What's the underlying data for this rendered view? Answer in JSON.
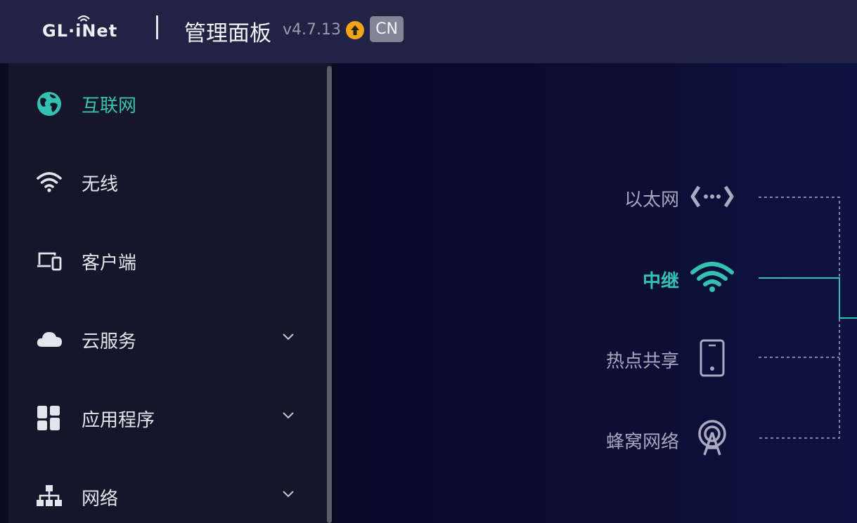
{
  "header": {
    "logo": "GL·iNet",
    "title": "管理面板",
    "version": "v4.7.13",
    "language": "CN",
    "upgrade_icon": "upgrade-arrow-icon"
  },
  "sidebar": {
    "items": [
      {
        "label": "互联网",
        "icon": "globe-icon",
        "active": true,
        "expandable": false
      },
      {
        "label": "无线",
        "icon": "wifi-icon",
        "active": false,
        "expandable": false
      },
      {
        "label": "客户端",
        "icon": "devices-icon",
        "active": false,
        "expandable": false
      },
      {
        "label": "云服务",
        "icon": "cloud-icon",
        "active": false,
        "expandable": true
      },
      {
        "label": "应用程序",
        "icon": "apps-grid-icon",
        "active": false,
        "expandable": true
      },
      {
        "label": "网络",
        "icon": "network-tree-icon",
        "active": false,
        "expandable": true
      }
    ]
  },
  "connections": [
    {
      "label": "以太网",
      "icon": "ethernet-icon",
      "active": false
    },
    {
      "label": "中继",
      "icon": "wifi-repeater-icon",
      "active": true
    },
    {
      "label": "热点共享",
      "icon": "phone-icon",
      "active": false
    },
    {
      "label": "蜂窝网络",
      "icon": "cellular-tower-icon",
      "active": false
    }
  ],
  "colors": {
    "accent": "#33c1b1",
    "header_bg": "#222344",
    "sidebar_bg": "#16162a",
    "upgrade": "#f0a51a"
  }
}
